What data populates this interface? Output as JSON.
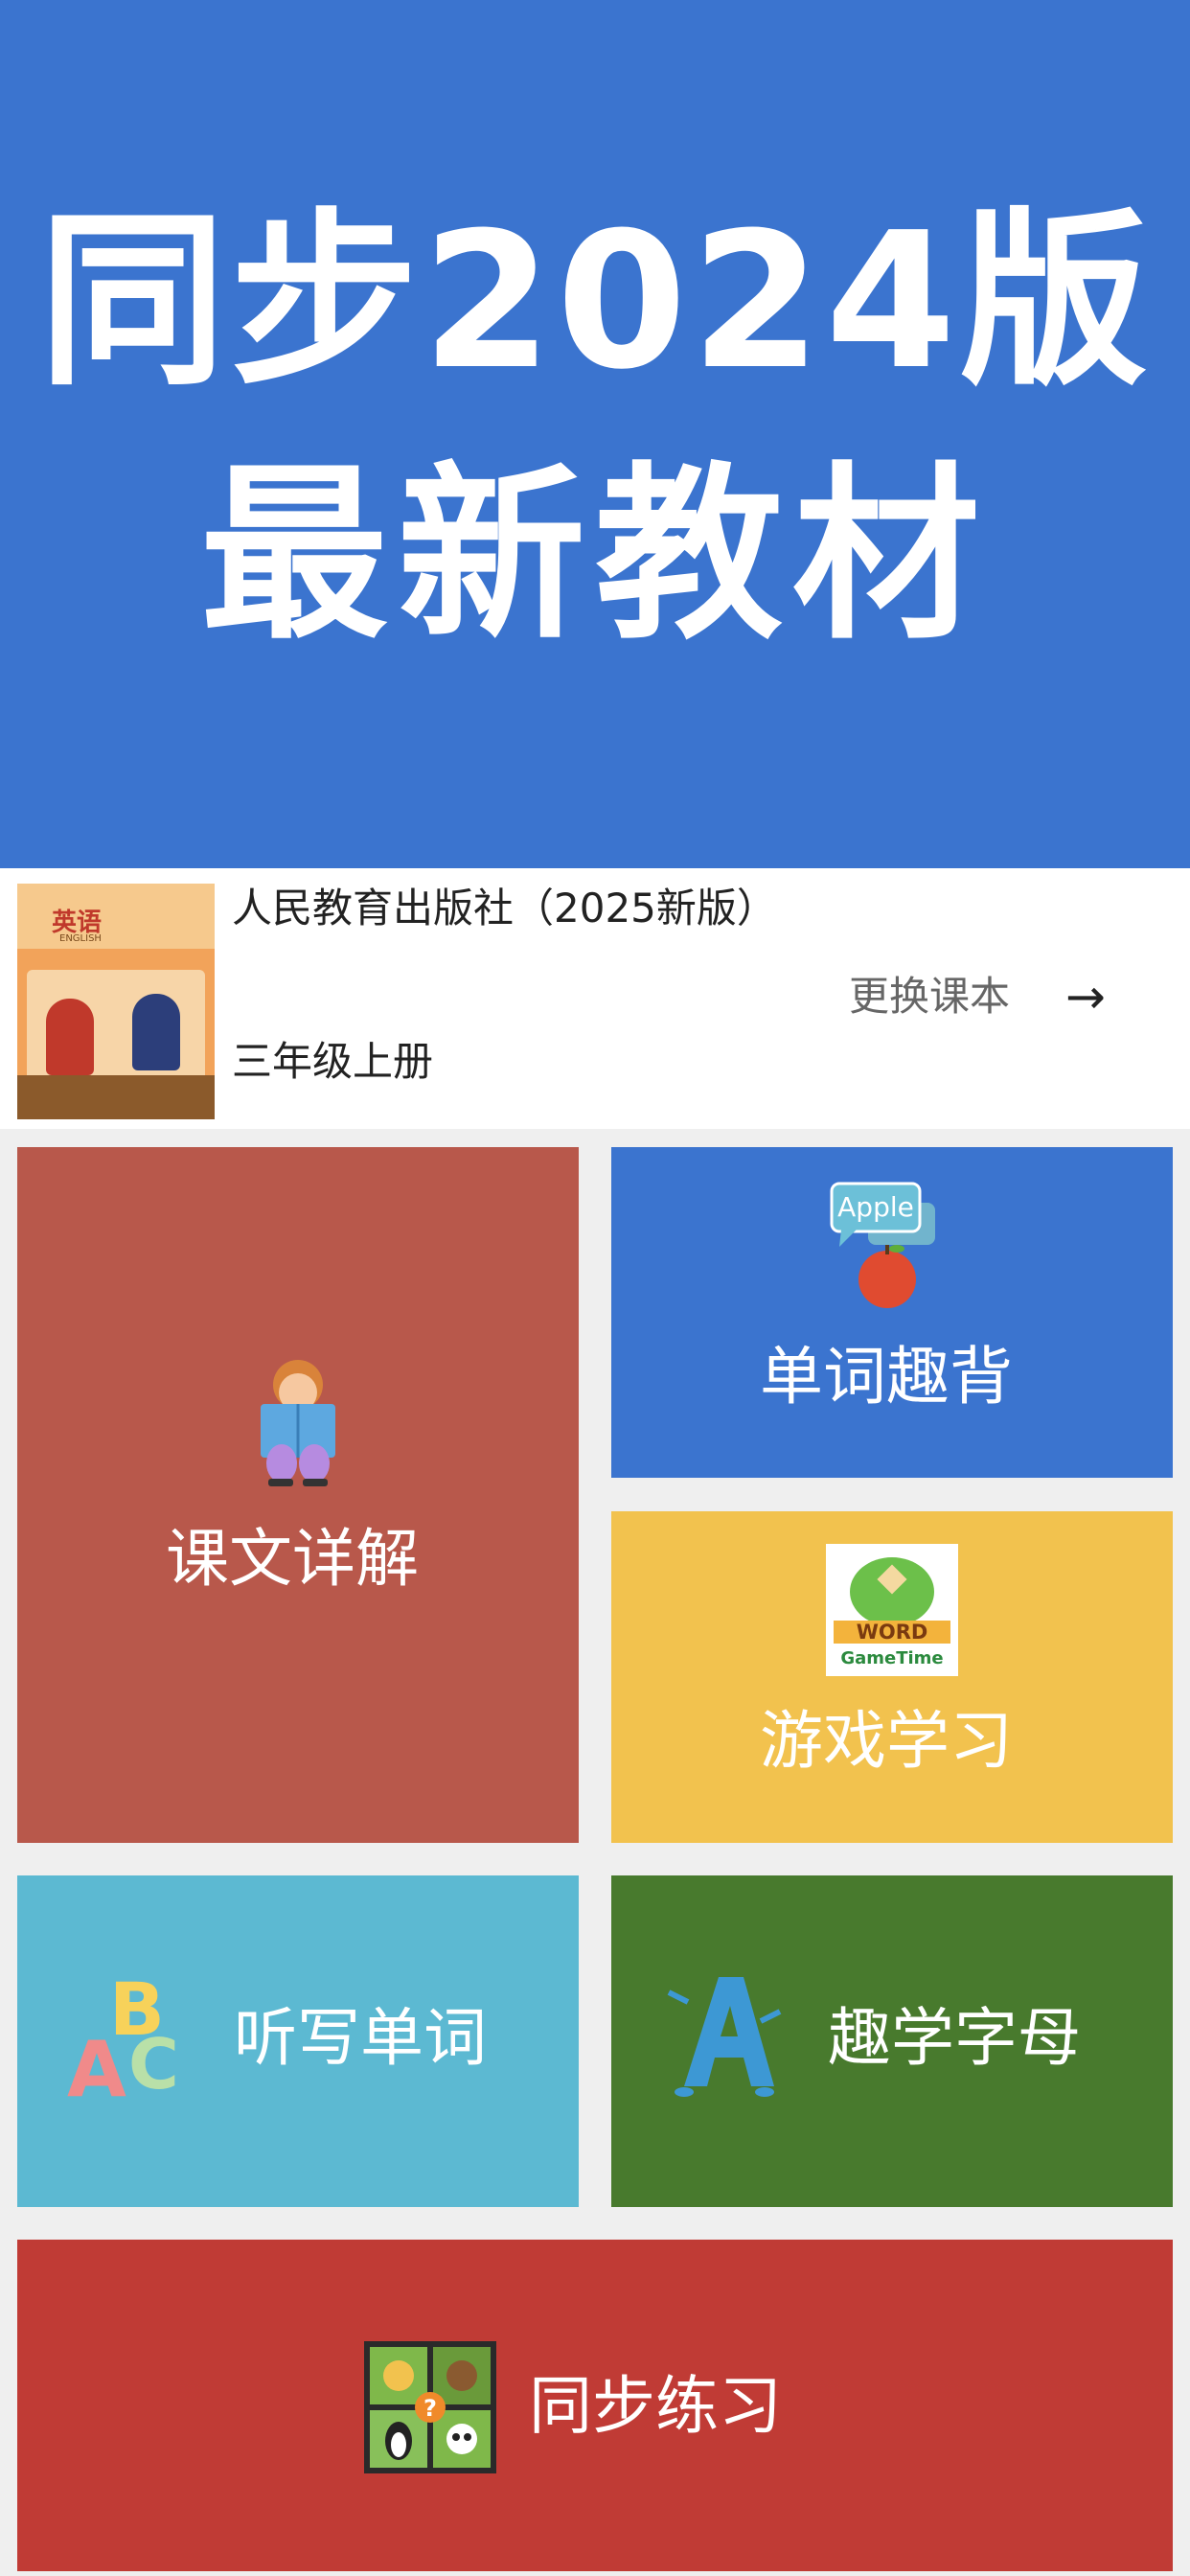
{
  "hero": {
    "line1": "同步2024版",
    "line2": "最新教材"
  },
  "book": {
    "cover_title": "英语",
    "cover_subtitle": "ENGLISH",
    "publisher": "人民教育出版社（2025新版）",
    "grade": "三年级上册",
    "change_label": "更换课本",
    "arrow": "→"
  },
  "tiles": {
    "text_detail": {
      "label": "课文详解",
      "color": "#b8584b",
      "icon": "girl-reading-icon"
    },
    "word_memorize": {
      "label": "单词趣背",
      "color": "#3b74cf",
      "icon": "apple-speech-icon",
      "icon_text": "Apple"
    },
    "game_study": {
      "label": "游戏学习",
      "color": "#f2c24e",
      "icon": "word-gametime-icon",
      "icon_text1": "WORD",
      "icon_text2": "GameTime"
    },
    "dictation": {
      "label": "听写单词",
      "color": "#5cb9d2",
      "icon": "abc-letters-icon"
    },
    "alphabet": {
      "label": "趣学字母",
      "color": "#487a2d",
      "icon": "letter-a-icon"
    },
    "practice": {
      "label": "同步练习",
      "color": "#c03b35",
      "icon": "animal-grid-icon"
    }
  }
}
